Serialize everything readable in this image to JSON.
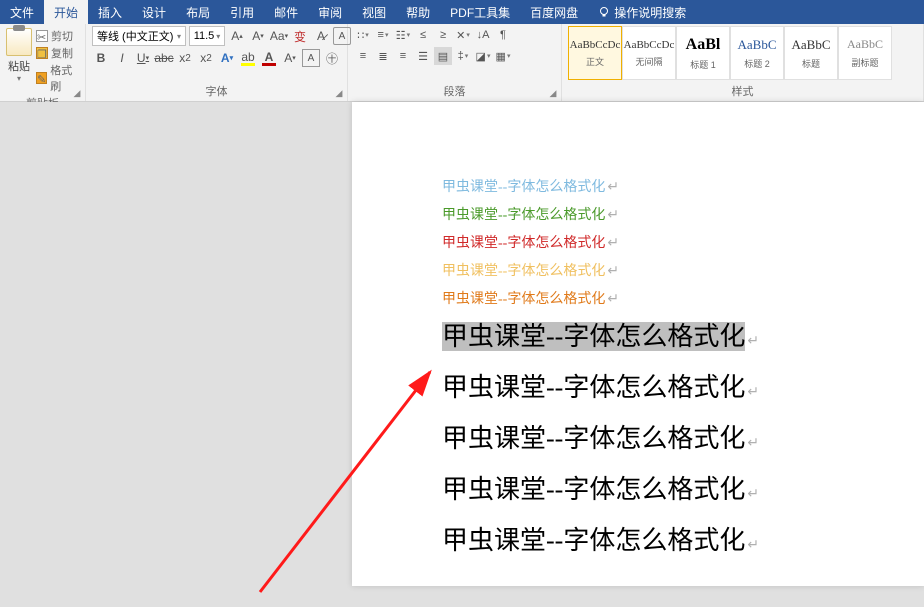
{
  "tabs": {
    "file": "文件",
    "home": "开始",
    "insert": "插入",
    "design": "设计",
    "layout": "布局",
    "references": "引用",
    "mailings": "邮件",
    "review": "审阅",
    "view": "视图",
    "help": "帮助",
    "pdf": "PDF工具集",
    "baidu": "百度网盘",
    "tell": "操作说明搜索"
  },
  "clipboard": {
    "paste": "粘贴",
    "cut": "剪切",
    "copy": "复制",
    "painter": "格式刷",
    "group": "剪贴板"
  },
  "font": {
    "name": "等线 (中文正文)",
    "size": "11.5",
    "group": "字体"
  },
  "paragraph": {
    "group": "段落"
  },
  "styles": {
    "group": "样式",
    "items": [
      {
        "preview": "AaBbCcDc",
        "label": "正文"
      },
      {
        "preview": "AaBbCcDc",
        "label": "无间隔"
      },
      {
        "preview": "AaBl",
        "label": "标题 1"
      },
      {
        "preview": "AaBbC",
        "label": "标题 2"
      },
      {
        "preview": "AaBbC",
        "label": "标题"
      },
      {
        "preview": "AaBbC",
        "label": "副标题"
      }
    ]
  },
  "doc": {
    "lines": [
      {
        "text": "甲虫课堂--字体怎么格式化",
        "color": "#7fbadf",
        "size": "small"
      },
      {
        "text": "甲虫课堂--字体怎么格式化",
        "color": "#4a9a2a",
        "size": "small"
      },
      {
        "text": "甲虫课堂--字体怎么格式化",
        "color": "#d02a2a",
        "size": "small"
      },
      {
        "text": "甲虫课堂--字体怎么格式化",
        "color": "#f0c060",
        "size": "small"
      },
      {
        "text": "甲虫课堂--字体怎么格式化",
        "color": "#e07a1a",
        "size": "small"
      },
      {
        "text": "甲虫课堂--字体怎么格式化",
        "color": "#000000",
        "size": "big",
        "selected": true
      },
      {
        "text": "甲虫课堂--字体怎么格式化",
        "color": "#000000",
        "size": "big"
      },
      {
        "text": "甲虫课堂--字体怎么格式化",
        "color": "#000000",
        "size": "big"
      },
      {
        "text": "甲虫课堂--字体怎么格式化",
        "color": "#000000",
        "size": "big"
      },
      {
        "text": "甲虫课堂--字体怎么格式化",
        "color": "#000000",
        "size": "big"
      }
    ]
  }
}
